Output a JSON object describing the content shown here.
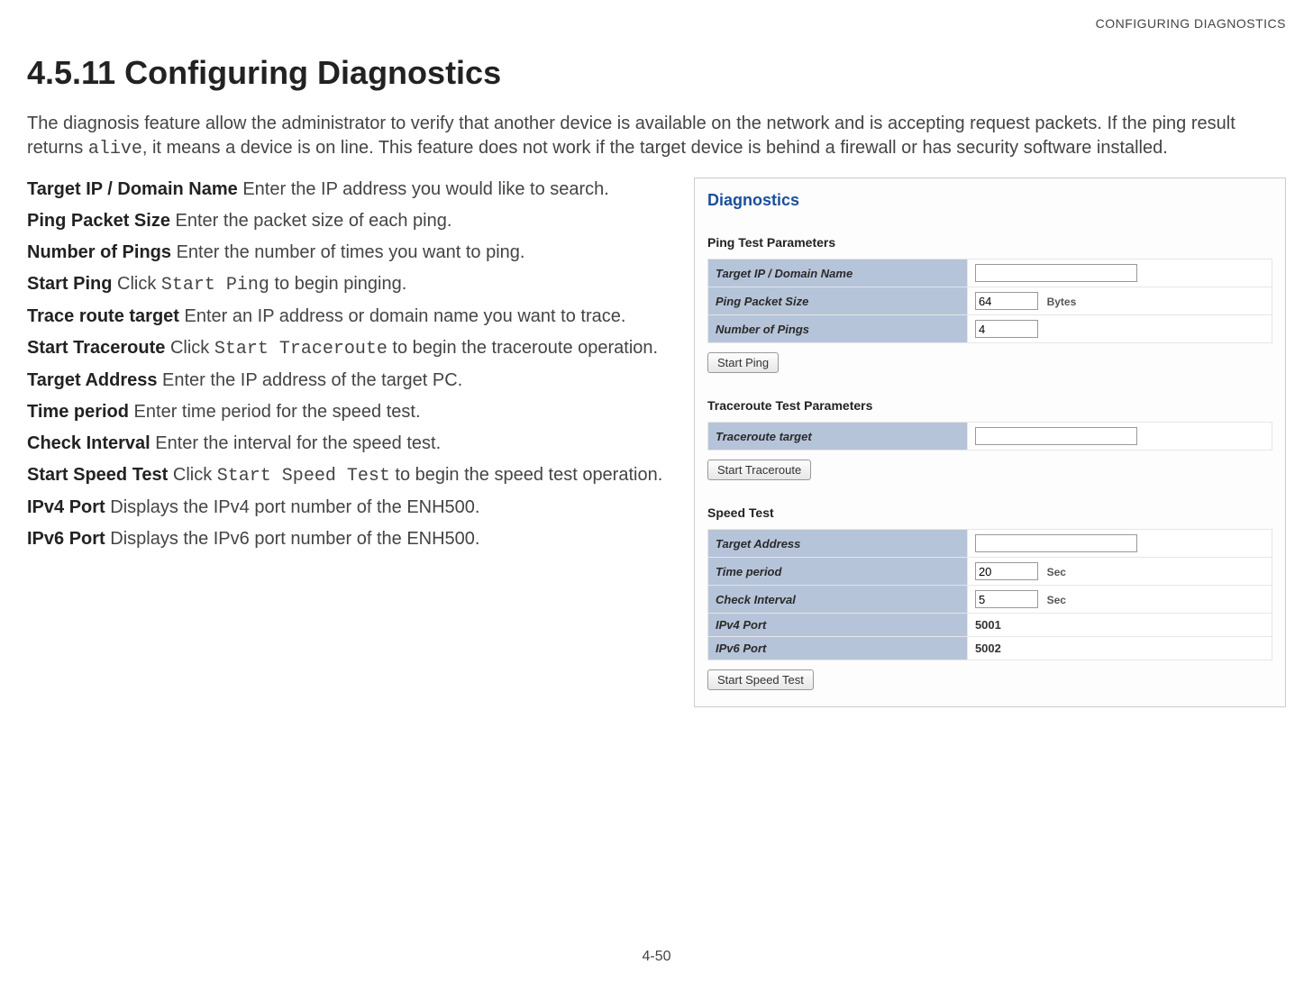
{
  "header": {
    "running_head": "CONFIGURING DIAGNOSTICS"
  },
  "heading": "4.5.11 Configuring Diagnostics",
  "intro": {
    "part1": "The diagnosis feature allow the administrator to verify that another device is available on the network and is accepting request packets. If the ping result returns ",
    "code": "alive",
    "part2": ", it means a device is on line. This feature does not work if the target device is behind a firewall or has security software installed."
  },
  "definitions": [
    {
      "term": "Target IP / Domain Name",
      "desc_pre": "  Enter the IP address you would like to search.",
      "code": "",
      "desc_post": ""
    },
    {
      "term": "Ping Packet Size",
      "desc_pre": "  Enter the packet size of each ping.",
      "code": "",
      "desc_post": ""
    },
    {
      "term": "Number of Pings",
      "desc_pre": "  Enter the number of times you want to ping.",
      "code": "",
      "desc_post": ""
    },
    {
      "term": "Start Ping",
      "desc_pre": "  Click ",
      "code": "Start Ping",
      "desc_post": " to begin pinging."
    },
    {
      "term": "Trace route target",
      "desc_pre": "  Enter an IP address or domain name you want to trace.",
      "code": "",
      "desc_post": ""
    },
    {
      "term": "Start Traceroute",
      "desc_pre": "  Click ",
      "code": "Start Traceroute",
      "desc_post": " to begin the traceroute operation."
    },
    {
      "term": "Target Address",
      "desc_pre": "  Enter the IP address of the target PC.",
      "code": "",
      "desc_post": ""
    },
    {
      "term": "Time period",
      "desc_pre": "  Enter time period for the speed test.",
      "code": "",
      "desc_post": ""
    },
    {
      "term": "Check Interval",
      "desc_pre": "  Enter the interval for the speed test.",
      "code": "",
      "desc_post": ""
    },
    {
      "term": "Start Speed Test",
      "desc_pre": "  Click ",
      "code": "Start Speed Test",
      "desc_post": " to begin the speed test operation."
    },
    {
      "term": "IPv4 Port",
      "desc_pre": "  Displays the IPv4 port number of the ENH500.",
      "code": "",
      "desc_post": ""
    },
    {
      "term": "IPv6 Port",
      "desc_pre": "  Displays the IPv6 port number of the ENH500.",
      "code": "",
      "desc_post": ""
    }
  ],
  "screenshot": {
    "title": "Diagnostics",
    "ping": {
      "heading": "Ping Test Parameters",
      "rows": {
        "target_ip_label": "Target IP / Domain Name",
        "target_ip_value": "",
        "packet_size_label": "Ping Packet Size",
        "packet_size_value": "64",
        "packet_size_unit": "Bytes",
        "num_pings_label": "Number of Pings",
        "num_pings_value": "4"
      },
      "button": "Start Ping"
    },
    "traceroute": {
      "heading": "Traceroute Test Parameters",
      "rows": {
        "target_label": "Traceroute target",
        "target_value": ""
      },
      "button": "Start Traceroute"
    },
    "speed": {
      "heading": "Speed Test",
      "rows": {
        "target_addr_label": "Target Address",
        "target_addr_value": "",
        "time_period_label": "Time period",
        "time_period_value": "20",
        "time_period_unit": "Sec",
        "check_interval_label": "Check Interval",
        "check_interval_value": "5",
        "check_interval_unit": "Sec",
        "ipv4_label": "IPv4 Port",
        "ipv4_value": "5001",
        "ipv6_label": "IPv6 Port",
        "ipv6_value": "5002"
      },
      "button": "Start Speed Test"
    }
  },
  "footer": "4-50"
}
